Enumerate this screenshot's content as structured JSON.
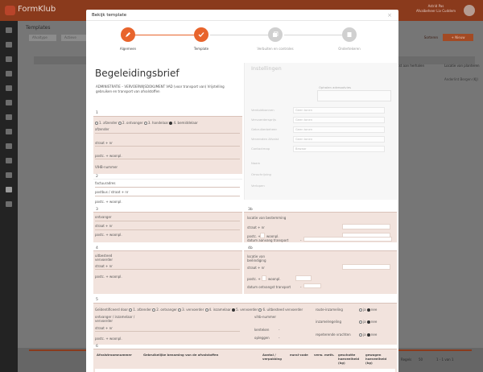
{
  "app": {
    "logo_text": "FormKlub",
    "user_name": "Astrid Pas",
    "user_sub": "Afvalbeheer Liv Cuddem"
  },
  "background": {
    "page_title": "Templates",
    "tab_1": "Afvaltype",
    "tab_2": "Actieve",
    "filter_label": "Sorteren",
    "new_button": "+ Nieuw",
    "col_header_1": "Laatst aan herhalen",
    "col_header_2": "Locatie van planteren",
    "row_cell": "Anderlint Bergen (KJ)",
    "pager_size_label": "Regels",
    "pager_size_value": "50",
    "pager_range": "1 - 1 van 1"
  },
  "modal": {
    "title": "Bekijk template",
    "close": "×"
  },
  "steps": [
    {
      "label": "Algemeen",
      "state": "done"
    },
    {
      "label": "Template",
      "state": "current"
    },
    {
      "label": "Verbuiten en controles",
      "state": "todo"
    },
    {
      "label": "Ondertekeren",
      "state": "todo"
    }
  ],
  "doc": {
    "title": "Begeleidingsbrief",
    "subtitle": "ADMINISTRATIE – VERVOERWIJSDOKUMENT VAD (voor transport van) Vrijstelling gebruiken en transport van afvalstoffen"
  },
  "settings": {
    "title": "Instellingen",
    "box_label": "Ophalen adresadvies",
    "rows": [
      {
        "label": "Verduidbonnen",
        "placeholder": "Geen tonen"
      },
      {
        "label": "Vervoerdersprijs",
        "placeholder": "Geen tonen"
      },
      {
        "label": "Gebruikerbeheer",
        "placeholder": "Geen tonen"
      },
      {
        "label": "Verzenden Afvalst",
        "placeholder": "Geen tonen"
      },
      {
        "label": "Contactmap",
        "placeholder": "Bewaar"
      }
    ],
    "extra": [
      "Naam",
      "Omschrijving",
      "Verlopen"
    ]
  },
  "form": {
    "s1": {
      "num": "1",
      "options": [
        "1. afzender",
        "2. ontvanger",
        "3. handelaar",
        "4. bemiddelaar"
      ],
      "selected": 3,
      "afzender": "afzender",
      "straat": "straat + nr",
      "postc": "postc. + woonpl.",
      "vihb": "VIHB-nummer"
    },
    "s2": {
      "num": "2",
      "factuuradres": "factuuradres",
      "postbus": "postbus / straat + nr",
      "postc": "postc. + woonpl."
    },
    "s3": {
      "num": "3",
      "ontvanger": "ontvanger",
      "straat": "straat + nr",
      "postc": "postc. + woonpl."
    },
    "s3b": {
      "num": "3b",
      "locatie": "locatie van bestemming",
      "straat": "straat + nr",
      "postc": "postc. +",
      "woonpl": "woonpl.",
      "datum": "datum aanvang transport",
      "dash": "-"
    },
    "s4": {
      "num": "4",
      "uitbesteed": "uitbesteed vervoerder",
      "straat": "straat + nr",
      "postc": "postc. + woonpl."
    },
    "s4b": {
      "num": "4b",
      "locatie": "locatie van beëindiging",
      "straat": "straat + nr",
      "postc": "postc. +",
      "woonpl": "woonpl.",
      "datum": "datum ontvangst transport",
      "dash": "-"
    },
    "s5": {
      "num": "5",
      "lead": "Geïdentificeerd door",
      "options": [
        "1. afzender",
        "2. ontvanger",
        "3. vervoerder",
        "4. inzamelaar",
        "5. vervoerder",
        "6. uitbesteed vervoerder"
      ],
      "selected": 4,
      "route_label": "route-inzameling",
      "yes": "ja",
      "no": "nee",
      "ontvanger": "ontvanger / inzamelaar / vervoerder",
      "straat": "straat + nr",
      "postc": "postc. + woonpl.",
      "vihb": "vihb-nummer",
      "kenteken": "kenteken",
      "opleggen": "opleggen",
      "dash": "-",
      "inzameling": "inzamelregeling",
      "ketenafval": "repeterende vrachten"
    },
    "s6": {
      "num": "6",
      "headers": [
        "Afvalstroomnummer",
        "Gebruikelijke benaming van de afvalstoffen",
        "Aantal / verpakking",
        "eural-code",
        "verw. meth.",
        "geschatte hoeveelheid (kg)",
        "gewogen hoeveelheid (kg)"
      ]
    }
  }
}
